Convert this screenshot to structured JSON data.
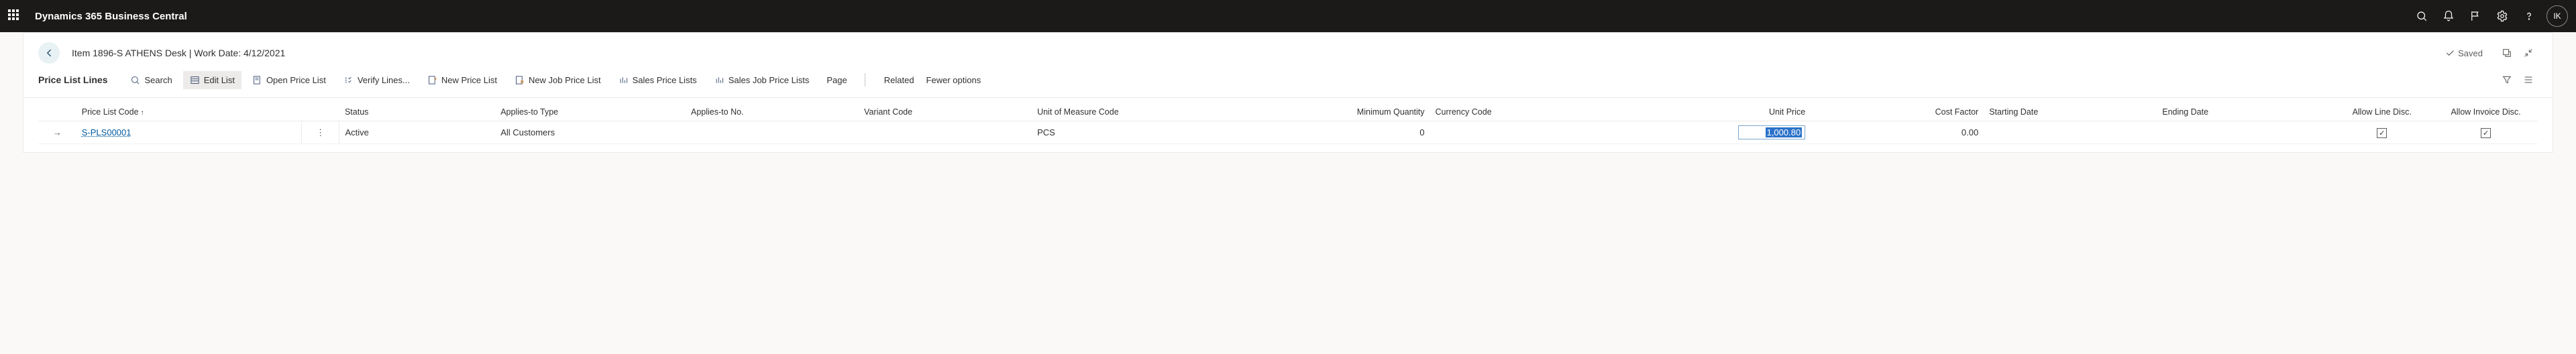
{
  "topbar": {
    "app_title": "Dynamics 365 Business Central",
    "avatar_initials": "IK"
  },
  "page_header": {
    "breadcrumb": "Item 1896-S ATHENS Desk | Work Date: 4/12/2021",
    "saved_label": "Saved"
  },
  "toolbar": {
    "title": "Price List Lines",
    "search": "Search",
    "edit_list": "Edit List",
    "open_price_list": "Open Price List",
    "verify_lines": "Verify Lines...",
    "new_price_list": "New Price List",
    "new_job_price_list": "New Job Price List",
    "sales_price_lists": "Sales Price Lists",
    "sales_job_price_lists": "Sales Job Price Lists",
    "page": "Page",
    "related": "Related",
    "fewer_options": "Fewer options"
  },
  "grid": {
    "headers": {
      "price_list_code": "Price List Code",
      "status": "Status",
      "applies_to_type": "Applies-to Type",
      "applies_to_no": "Applies-to No.",
      "variant_code": "Variant Code",
      "unit_of_measure": "Unit of Measure Code",
      "min_qty": "Minimum Quantity",
      "currency_code": "Currency Code",
      "unit_price": "Unit Price",
      "cost_factor": "Cost Factor",
      "starting_date": "Starting Date",
      "ending_date": "Ending Date",
      "allow_line_disc": "Allow Line Disc.",
      "allow_invoice_disc": "Allow Invoice Disc."
    },
    "rows": [
      {
        "price_list_code": "S-PLS00001",
        "status": "Active",
        "applies_to_type": "All Customers",
        "applies_to_no": "",
        "variant_code": "",
        "unit_of_measure": "PCS",
        "min_qty": "0",
        "currency_code": "",
        "unit_price": "1,000.80",
        "cost_factor": "0.00",
        "starting_date": "",
        "ending_date": "",
        "allow_line_disc": true,
        "allow_invoice_disc": true
      }
    ]
  }
}
